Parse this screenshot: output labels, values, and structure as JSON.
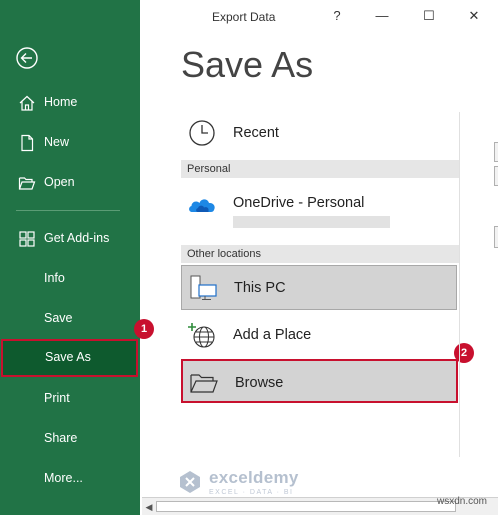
{
  "window": {
    "title": "Export Data",
    "help_glyph": "?",
    "minimize_glyph": "—",
    "restore_glyph": "☐",
    "close_glyph": "✕"
  },
  "sidebar": {
    "background": "#217346",
    "items": [
      {
        "label": "Home",
        "icon": "home-icon"
      },
      {
        "label": "New",
        "icon": "new-document-icon"
      },
      {
        "label": "Open",
        "icon": "open-folder-icon"
      },
      {
        "label": "Get Add-ins",
        "icon": "add-ins-grid-icon"
      },
      {
        "label": "Info"
      },
      {
        "label": "Save"
      },
      {
        "label": "Save As",
        "selected": true
      },
      {
        "label": "Print"
      },
      {
        "label": "Share"
      },
      {
        "label": "More..."
      }
    ]
  },
  "main": {
    "title": "Save As",
    "recent_label": "Recent",
    "personal_header": "Personal",
    "onedrive_label": "OneDrive - Personal",
    "other_locations_header": "Other locations",
    "this_pc_label": "This PC",
    "add_place_label": "Add a Place",
    "browse_label": "Browse"
  },
  "annotations": {
    "badge_1": "1",
    "badge_2": "2",
    "highlight_color": "#c8102e"
  },
  "watermark": {
    "name": "exceldemy",
    "tagline": "EXCEL · DATA · BI"
  },
  "credit": "wsxdn.com"
}
